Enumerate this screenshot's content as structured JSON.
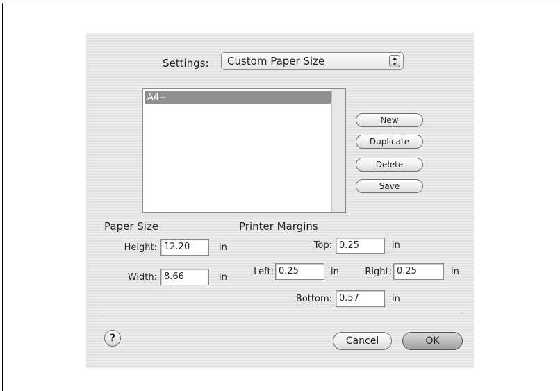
{
  "settings": {
    "label": "Settings:",
    "value": "Custom Paper Size"
  },
  "paper_list": {
    "items": [
      {
        "label": "A4+",
        "selected": true
      }
    ]
  },
  "side_buttons": {
    "new": "New",
    "duplicate": "Duplicate",
    "delete": "Delete",
    "save": "Save"
  },
  "paper_size": {
    "title": "Paper Size",
    "height": {
      "label": "Height:",
      "value": "12.20",
      "unit": "in"
    },
    "width": {
      "label": "Width:",
      "value": "8.66",
      "unit": "in"
    }
  },
  "printer_margins": {
    "title": "Printer Margins",
    "top": {
      "label": "Top:",
      "value": "0.25",
      "unit": "in"
    },
    "left": {
      "label": "Left:",
      "value": "0.25",
      "unit": "in"
    },
    "right": {
      "label": "Right:",
      "value": "0.25",
      "unit": "in"
    },
    "bottom": {
      "label": "Bottom:",
      "value": "0.57",
      "unit": "in"
    }
  },
  "footer": {
    "help": "?",
    "cancel": "Cancel",
    "ok": "OK"
  }
}
